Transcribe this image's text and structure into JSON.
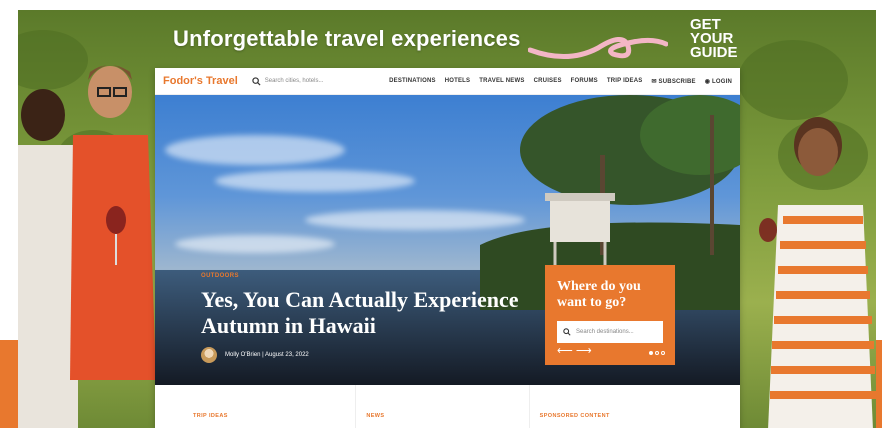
{
  "ad": {
    "headline": "Unforgettable travel experiences",
    "cta": "GET YOUR GUIDE"
  },
  "nav": {
    "logo": "Fodor's Travel",
    "search_placeholder": "Search cities, hotels...",
    "links": [
      "DESTINATIONS",
      "HOTELS",
      "TRAVEL NEWS",
      "CRUISES",
      "FORUMS",
      "TRIP IDEAS"
    ],
    "subscribe": "SUBSCRIBE",
    "login": "LOGIN"
  },
  "hero": {
    "category": "OUTDOORS",
    "title": "Yes, You Can Actually Experience Autumn in Hawaii",
    "byline": "Molly O'Brien | August 23, 2022"
  },
  "destination_widget": {
    "heading": "Where do you want to go?",
    "placeholder": "Search destinations..."
  },
  "sections": [
    "TRIP IDEAS",
    "NEWS",
    "SPONSORED CONTENT"
  ],
  "colors": {
    "accent": "#e8782e"
  }
}
